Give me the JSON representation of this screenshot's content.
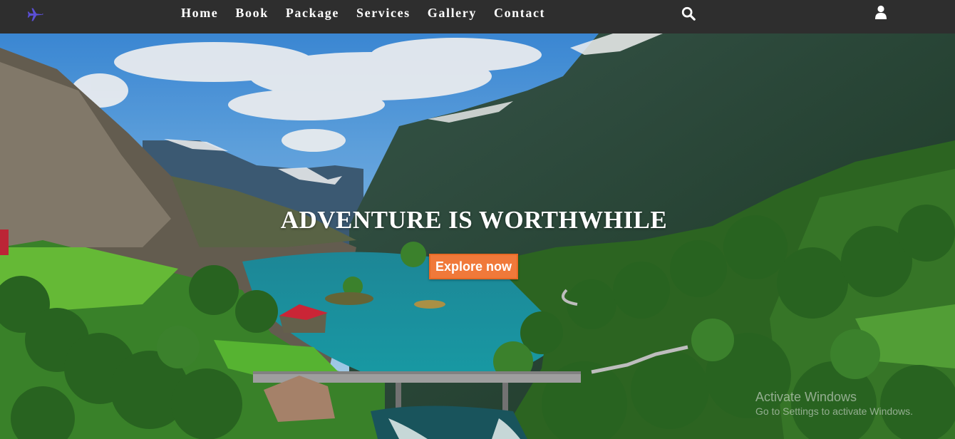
{
  "nav": {
    "logo_icon": "airplane-icon",
    "links": [
      "Home",
      "Book",
      "Package",
      "Services",
      "Gallery",
      "Contact"
    ],
    "search_icon": "search-icon",
    "user_icon": "user-icon",
    "background": "#2e2e2e",
    "logo_color": "#5b4fd6"
  },
  "hero": {
    "title": "ADVENTURE IS WORTHWHILE",
    "button_label": "Explore now",
    "button_color": "#f0793a"
  },
  "watermark": {
    "title": "Activate Windows",
    "subtitle": "Go to Settings to activate Windows."
  }
}
